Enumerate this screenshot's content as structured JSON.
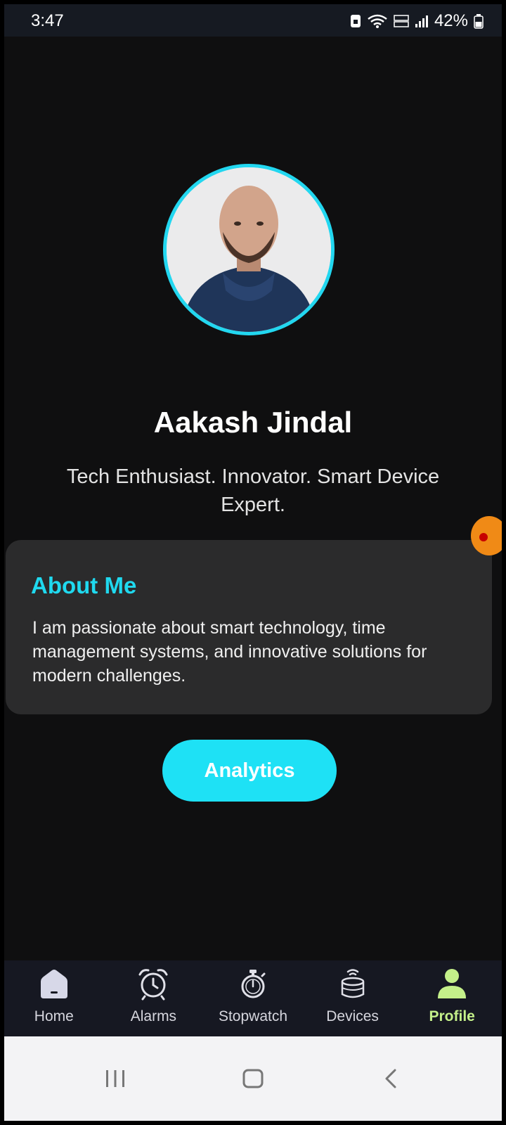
{
  "status_bar": {
    "time": "3:47",
    "battery": "42%"
  },
  "profile": {
    "name": "Aakash Jindal",
    "tagline": "Tech Enthusiast. Innovator. Smart Device Expert."
  },
  "about": {
    "title": "About Me",
    "text": "I am passionate about smart technology, time management systems, and innovative solutions for modern challenges."
  },
  "actions": {
    "analytics_label": "Analytics"
  },
  "bottom_nav": {
    "items": [
      {
        "label": "Home",
        "icon": "home-icon",
        "active": false
      },
      {
        "label": "Alarms",
        "icon": "alarm-clock-icon",
        "active": false
      },
      {
        "label": "Stopwatch",
        "icon": "stopwatch-icon",
        "active": false
      },
      {
        "label": "Devices",
        "icon": "smart-speaker-icon",
        "active": false
      },
      {
        "label": "Profile",
        "icon": "person-icon",
        "active": true
      }
    ]
  },
  "colors": {
    "accent": "#1ee1f5",
    "active_tab": "#c4f08a",
    "card": "#2b2b2c",
    "background": "#0f0f10"
  }
}
